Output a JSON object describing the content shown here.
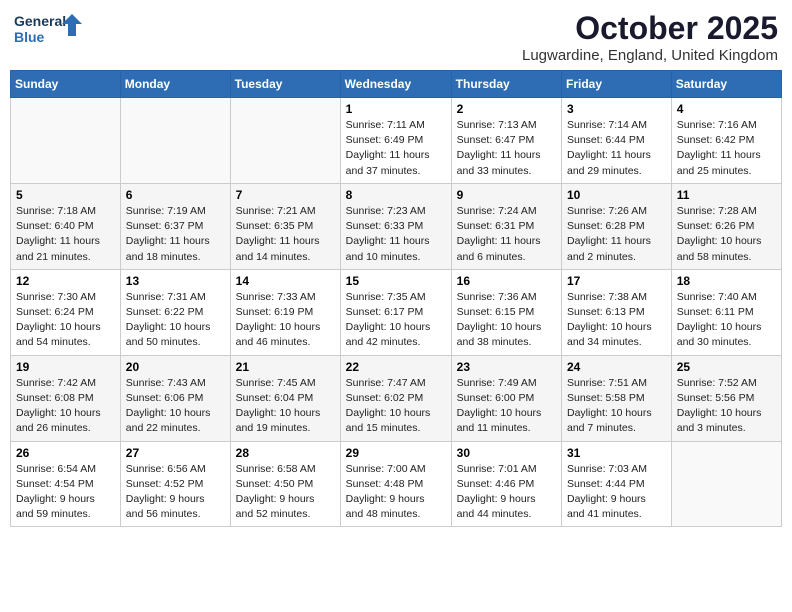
{
  "logo": {
    "line1": "General",
    "line2": "Blue"
  },
  "title": "October 2025",
  "subtitle": "Lugwardine, England, United Kingdom",
  "weekdays": [
    "Sunday",
    "Monday",
    "Tuesday",
    "Wednesday",
    "Thursday",
    "Friday",
    "Saturday"
  ],
  "weeks": [
    [
      {
        "day": "",
        "info": ""
      },
      {
        "day": "",
        "info": ""
      },
      {
        "day": "",
        "info": ""
      },
      {
        "day": "1",
        "info": "Sunrise: 7:11 AM\nSunset: 6:49 PM\nDaylight: 11 hours\nand 37 minutes."
      },
      {
        "day": "2",
        "info": "Sunrise: 7:13 AM\nSunset: 6:47 PM\nDaylight: 11 hours\nand 33 minutes."
      },
      {
        "day": "3",
        "info": "Sunrise: 7:14 AM\nSunset: 6:44 PM\nDaylight: 11 hours\nand 29 minutes."
      },
      {
        "day": "4",
        "info": "Sunrise: 7:16 AM\nSunset: 6:42 PM\nDaylight: 11 hours\nand 25 minutes."
      }
    ],
    [
      {
        "day": "5",
        "info": "Sunrise: 7:18 AM\nSunset: 6:40 PM\nDaylight: 11 hours\nand 21 minutes."
      },
      {
        "day": "6",
        "info": "Sunrise: 7:19 AM\nSunset: 6:37 PM\nDaylight: 11 hours\nand 18 minutes."
      },
      {
        "day": "7",
        "info": "Sunrise: 7:21 AM\nSunset: 6:35 PM\nDaylight: 11 hours\nand 14 minutes."
      },
      {
        "day": "8",
        "info": "Sunrise: 7:23 AM\nSunset: 6:33 PM\nDaylight: 11 hours\nand 10 minutes."
      },
      {
        "day": "9",
        "info": "Sunrise: 7:24 AM\nSunset: 6:31 PM\nDaylight: 11 hours\nand 6 minutes."
      },
      {
        "day": "10",
        "info": "Sunrise: 7:26 AM\nSunset: 6:28 PM\nDaylight: 11 hours\nand 2 minutes."
      },
      {
        "day": "11",
        "info": "Sunrise: 7:28 AM\nSunset: 6:26 PM\nDaylight: 10 hours\nand 58 minutes."
      }
    ],
    [
      {
        "day": "12",
        "info": "Sunrise: 7:30 AM\nSunset: 6:24 PM\nDaylight: 10 hours\nand 54 minutes."
      },
      {
        "day": "13",
        "info": "Sunrise: 7:31 AM\nSunset: 6:22 PM\nDaylight: 10 hours\nand 50 minutes."
      },
      {
        "day": "14",
        "info": "Sunrise: 7:33 AM\nSunset: 6:19 PM\nDaylight: 10 hours\nand 46 minutes."
      },
      {
        "day": "15",
        "info": "Sunrise: 7:35 AM\nSunset: 6:17 PM\nDaylight: 10 hours\nand 42 minutes."
      },
      {
        "day": "16",
        "info": "Sunrise: 7:36 AM\nSunset: 6:15 PM\nDaylight: 10 hours\nand 38 minutes."
      },
      {
        "day": "17",
        "info": "Sunrise: 7:38 AM\nSunset: 6:13 PM\nDaylight: 10 hours\nand 34 minutes."
      },
      {
        "day": "18",
        "info": "Sunrise: 7:40 AM\nSunset: 6:11 PM\nDaylight: 10 hours\nand 30 minutes."
      }
    ],
    [
      {
        "day": "19",
        "info": "Sunrise: 7:42 AM\nSunset: 6:08 PM\nDaylight: 10 hours\nand 26 minutes."
      },
      {
        "day": "20",
        "info": "Sunrise: 7:43 AM\nSunset: 6:06 PM\nDaylight: 10 hours\nand 22 minutes."
      },
      {
        "day": "21",
        "info": "Sunrise: 7:45 AM\nSunset: 6:04 PM\nDaylight: 10 hours\nand 19 minutes."
      },
      {
        "day": "22",
        "info": "Sunrise: 7:47 AM\nSunset: 6:02 PM\nDaylight: 10 hours\nand 15 minutes."
      },
      {
        "day": "23",
        "info": "Sunrise: 7:49 AM\nSunset: 6:00 PM\nDaylight: 10 hours\nand 11 minutes."
      },
      {
        "day": "24",
        "info": "Sunrise: 7:51 AM\nSunset: 5:58 PM\nDaylight: 10 hours\nand 7 minutes."
      },
      {
        "day": "25",
        "info": "Sunrise: 7:52 AM\nSunset: 5:56 PM\nDaylight: 10 hours\nand 3 minutes."
      }
    ],
    [
      {
        "day": "26",
        "info": "Sunrise: 6:54 AM\nSunset: 4:54 PM\nDaylight: 9 hours\nand 59 minutes."
      },
      {
        "day": "27",
        "info": "Sunrise: 6:56 AM\nSunset: 4:52 PM\nDaylight: 9 hours\nand 56 minutes."
      },
      {
        "day": "28",
        "info": "Sunrise: 6:58 AM\nSunset: 4:50 PM\nDaylight: 9 hours\nand 52 minutes."
      },
      {
        "day": "29",
        "info": "Sunrise: 7:00 AM\nSunset: 4:48 PM\nDaylight: 9 hours\nand 48 minutes."
      },
      {
        "day": "30",
        "info": "Sunrise: 7:01 AM\nSunset: 4:46 PM\nDaylight: 9 hours\nand 44 minutes."
      },
      {
        "day": "31",
        "info": "Sunrise: 7:03 AM\nSunset: 4:44 PM\nDaylight: 9 hours\nand 41 minutes."
      },
      {
        "day": "",
        "info": ""
      }
    ]
  ]
}
